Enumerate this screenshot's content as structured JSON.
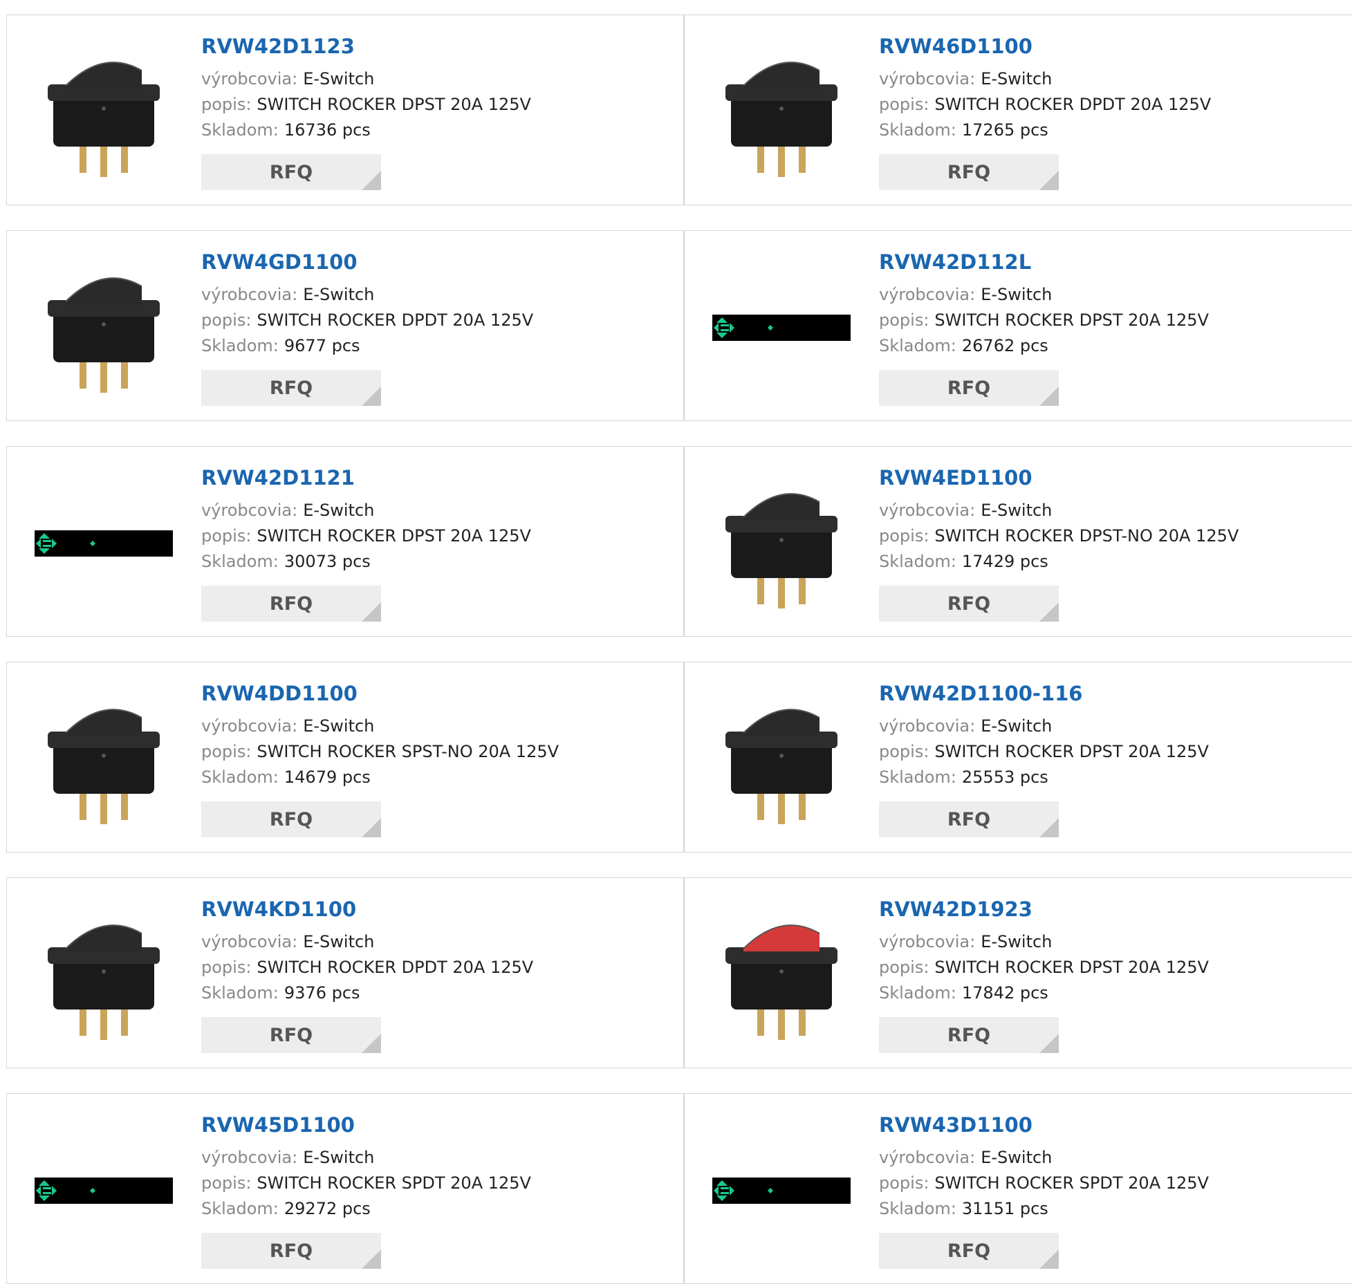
{
  "labels": {
    "manufacturer": "výrobcovia:",
    "description": "popis:",
    "stock": "Skladom:",
    "rfq": "RFQ"
  },
  "colors": {
    "part_link": "#1a66b0",
    "label_gray": "#888888",
    "rfq_bg": "#ededed",
    "border": "#d6d6d6",
    "placeholder_green": "#19c98a"
  },
  "products": [
    {
      "part": "RVW42D1123",
      "manufacturer": "E-Switch",
      "description": "SWITCH ROCKER DPST 20A 125V",
      "stock": "16736 pcs",
      "image": "black-rocker-switch-photo"
    },
    {
      "part": "RVW46D1100",
      "manufacturer": "E-Switch",
      "description": "SWITCH ROCKER DPDT 20A 125V",
      "stock": "17265 pcs",
      "image": "black-rocker-switch-photo"
    },
    {
      "part": "RVW4GD1100",
      "manufacturer": "E-Switch",
      "description": "SWITCH ROCKER DPDT 20A 125V",
      "stock": "9677 pcs",
      "image": "black-rocker-switch-photo"
    },
    {
      "part": "RVW42D112L",
      "manufacturer": "E-Switch",
      "description": "SWITCH ROCKER DPST 20A 125V",
      "stock": "26762 pcs",
      "image": "placeholder-bar"
    },
    {
      "part": "RVW42D1121",
      "manufacturer": "E-Switch",
      "description": "SWITCH ROCKER DPST 20A 125V",
      "stock": "30073 pcs",
      "image": "placeholder-bar"
    },
    {
      "part": "RVW4ED1100",
      "manufacturer": "E-Switch",
      "description": "SWITCH ROCKER DPST-NO 20A 125V",
      "stock": "17429 pcs",
      "image": "black-rocker-switch-photo"
    },
    {
      "part": "RVW4DD1100",
      "manufacturer": "E-Switch",
      "description": "SWITCH ROCKER SPST-NO 20A 125V",
      "stock": "14679 pcs",
      "image": "black-rocker-switch-photo"
    },
    {
      "part": "RVW42D1100-116",
      "manufacturer": "E-Switch",
      "description": "SWITCH ROCKER DPST 20A 125V",
      "stock": "25553 pcs",
      "image": "black-rocker-switch-photo"
    },
    {
      "part": "RVW4KD1100",
      "manufacturer": "E-Switch",
      "description": "SWITCH ROCKER DPDT 20A 125V",
      "stock": "9376 pcs",
      "image": "black-rocker-switch-photo"
    },
    {
      "part": "RVW42D1923",
      "manufacturer": "E-Switch",
      "description": "SWITCH ROCKER DPST 20A 125V",
      "stock": "17842 pcs",
      "image": "red-rocker-switch-photo"
    },
    {
      "part": "RVW45D1100",
      "manufacturer": "E-Switch",
      "description": "SWITCH ROCKER SPDT 20A 125V",
      "stock": "29272 pcs",
      "image": "placeholder-bar"
    },
    {
      "part": "RVW43D1100",
      "manufacturer": "E-Switch",
      "description": "SWITCH ROCKER SPDT 20A 125V",
      "stock": "31151 pcs",
      "image": "placeholder-bar"
    }
  ]
}
